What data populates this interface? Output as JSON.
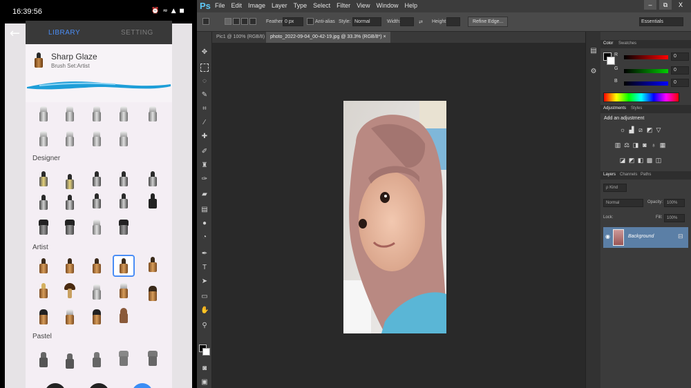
{
  "phone": {
    "status": {
      "time": "16:39:56",
      "icons": "⏰ ≈ ▲ ◼"
    },
    "tabs": {
      "library": "LIBRARY",
      "setting": "SETTING"
    },
    "selected_brush": {
      "name": "Sharp Glaze",
      "set": "Brush Set:Artist"
    },
    "sections": {
      "designer": "Designer",
      "artist": "Artist",
      "pastel": "Pastel"
    },
    "back_icon": "back-arrow-icon",
    "colors": {
      "accent": "#4a8df5",
      "stroke": "#1e9ed8"
    }
  },
  "ps": {
    "logo": "Ps",
    "menu": [
      "File",
      "Edit",
      "Image",
      "Layer",
      "Type",
      "Select",
      "Filter",
      "View",
      "Window",
      "Help"
    ],
    "window_controls": [
      "–",
      "⧉",
      "X"
    ],
    "options": {
      "feather_label": "Feather:",
      "feather_value": "0 px",
      "antialias_label": "Anti-alias",
      "style_label": "Style:",
      "style_value": "Normal",
      "width_label": "Width:",
      "height_label": "Height:",
      "refine_edge": "Refine Edge...",
      "workspace": "Essentials"
    },
    "doc_tabs": [
      {
        "label": "Pic1 @ 100% (RGB/8) ×"
      },
      {
        "label": "photo_2022-09-04_00-42-19.jpg @ 33.3% (RGB/8*) ×"
      }
    ],
    "color_panel": {
      "tabs": [
        "Color",
        "Swatches"
      ],
      "channels": [
        {
          "label": "R",
          "value": "0"
        },
        {
          "label": "G",
          "value": "0"
        },
        {
          "label": "B",
          "value": "0"
        }
      ]
    },
    "adjustments_panel": {
      "tabs": [
        "Adjustments",
        "Styles"
      ],
      "heading": "Add an adjustment"
    },
    "layers_panel": {
      "tabs": [
        "Layers",
        "Channels",
        "Paths"
      ],
      "kind": "ρ Kind",
      "blend_mode": "Normal",
      "opacity_label": "Opacity:",
      "opacity_value": "100%",
      "lock_label": "Lock:",
      "fill_label": "Fill:",
      "fill_value": "100%",
      "layer_name": "Background",
      "lock_icon": "lock-icon"
    }
  }
}
